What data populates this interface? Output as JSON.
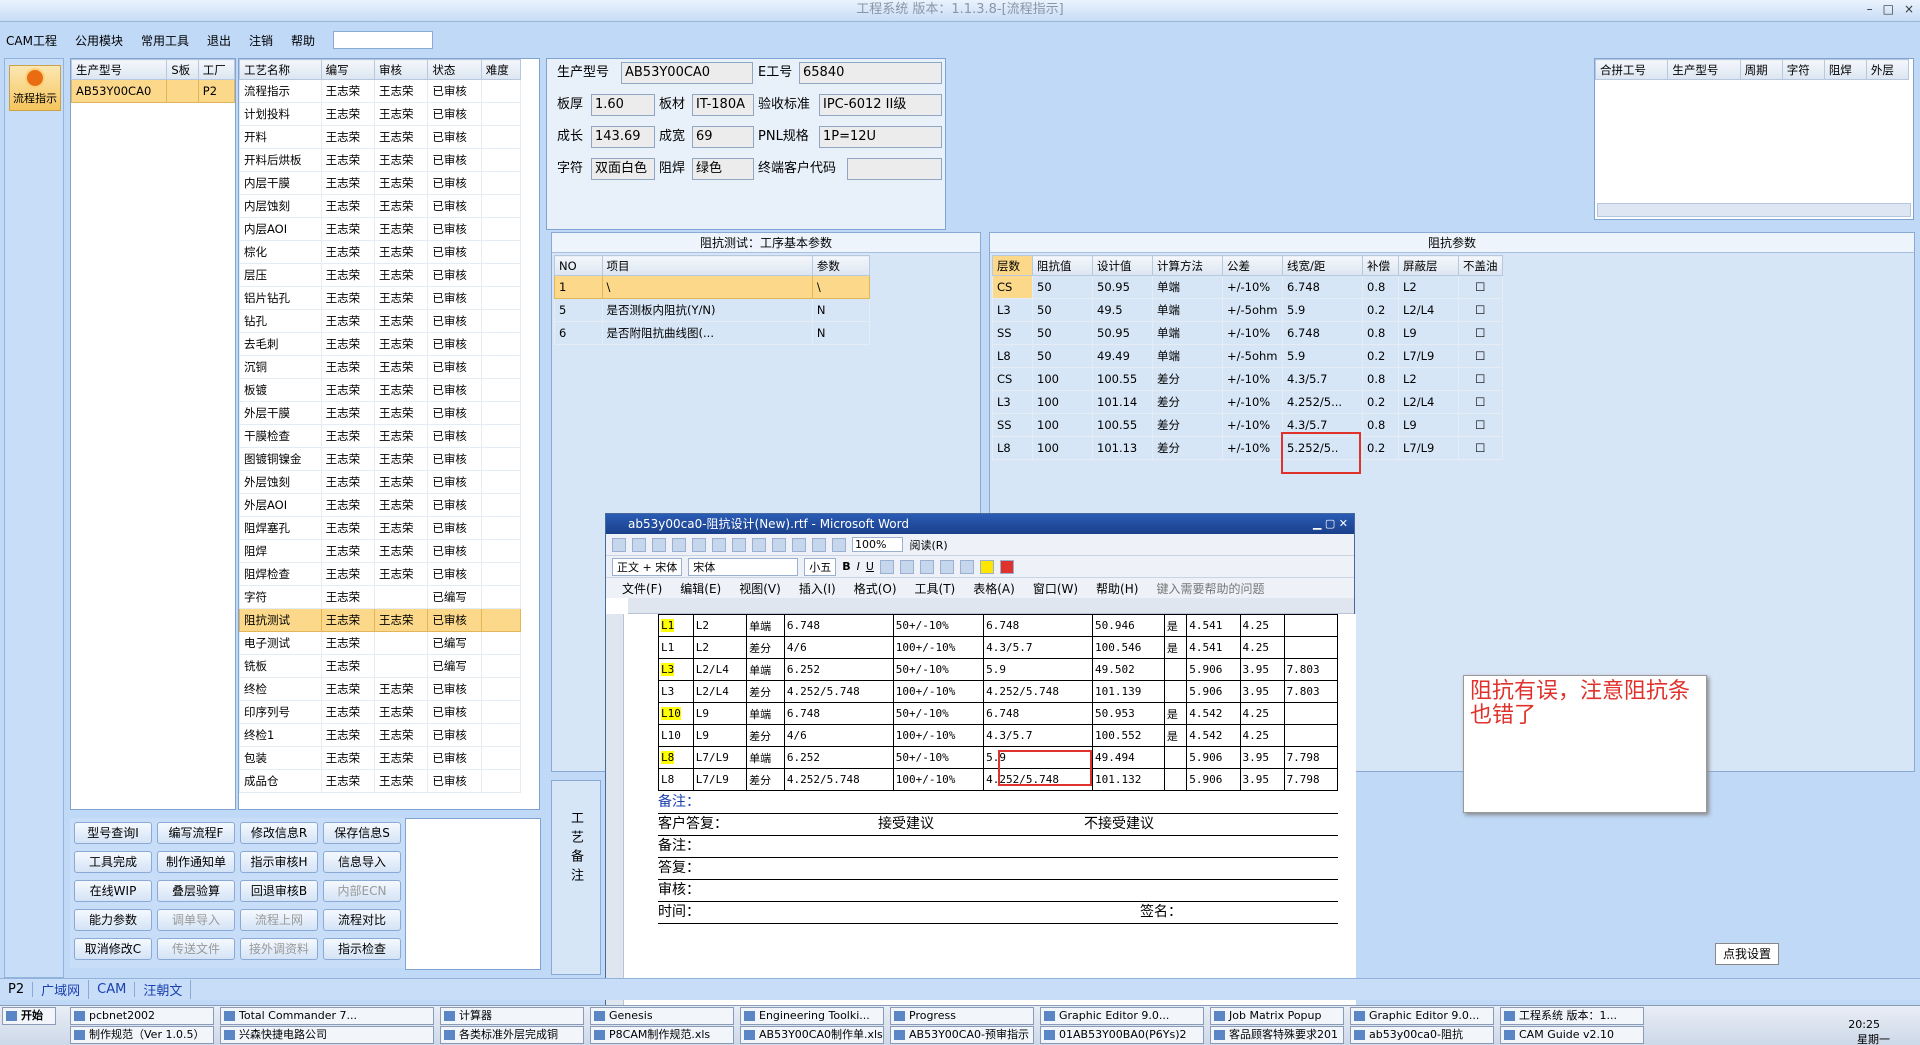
{
  "title": "工程系统 版本：1.1.3.8-[流程指示]",
  "window_buttons": [
    "–",
    "□",
    "×"
  ],
  "menu": [
    "CAM工程",
    "公用模块",
    "常用工具",
    "退出",
    "注销",
    "帮助"
  ],
  "nav": {
    "label": "流程指示"
  },
  "orders": {
    "headers": [
      "生产型号",
      "S板",
      "工厂"
    ],
    "rows": [
      [
        "AB53Y00CA0",
        "",
        "P2"
      ]
    ]
  },
  "process": {
    "headers": [
      "工艺名称",
      "编写",
      "审核",
      "状态",
      "难度"
    ],
    "rows": [
      [
        "流程指示",
        "王志荣",
        "王志荣",
        "已审核",
        ""
      ],
      [
        "计划投料",
        "王志荣",
        "王志荣",
        "已审核",
        ""
      ],
      [
        "开料",
        "王志荣",
        "王志荣",
        "已审核",
        ""
      ],
      [
        "开料后烘板",
        "王志荣",
        "王志荣",
        "已审核",
        ""
      ],
      [
        "内层干膜",
        "王志荣",
        "王志荣",
        "已审核",
        ""
      ],
      [
        "内层蚀刻",
        "王志荣",
        "王志荣",
        "已审核",
        ""
      ],
      [
        "内层AOI",
        "王志荣",
        "王志荣",
        "已审核",
        ""
      ],
      [
        "棕化",
        "王志荣",
        "王志荣",
        "已审核",
        ""
      ],
      [
        "层压",
        "王志荣",
        "王志荣",
        "已审核",
        ""
      ],
      [
        "铝片钻孔",
        "王志荣",
        "王志荣",
        "已审核",
        ""
      ],
      [
        "钻孔",
        "王志荣",
        "王志荣",
        "已审核",
        ""
      ],
      [
        "去毛刺",
        "王志荣",
        "王志荣",
        "已审核",
        ""
      ],
      [
        "沉铜",
        "王志荣",
        "王志荣",
        "已审核",
        ""
      ],
      [
        "板镀",
        "王志荣",
        "王志荣",
        "已审核",
        ""
      ],
      [
        "外层干膜",
        "王志荣",
        "王志荣",
        "已审核",
        ""
      ],
      [
        "干膜检查",
        "王志荣",
        "王志荣",
        "已审核",
        ""
      ],
      [
        "图镀铜镍金",
        "王志荣",
        "王志荣",
        "已审核",
        ""
      ],
      [
        "外层蚀刻",
        "王志荣",
        "王志荣",
        "已审核",
        ""
      ],
      [
        "外层AOI",
        "王志荣",
        "王志荣",
        "已审核",
        ""
      ],
      [
        "阻焊塞孔",
        "王志荣",
        "王志荣",
        "已审核",
        ""
      ],
      [
        "阻焊",
        "王志荣",
        "王志荣",
        "已审核",
        ""
      ],
      [
        "阻焊检查",
        "王志荣",
        "王志荣",
        "已审核",
        ""
      ],
      [
        "字符",
        "王志荣",
        "",
        "已编写",
        ""
      ],
      [
        "阻抗测试",
        "王志荣",
        "王志荣",
        "已审核",
        ""
      ],
      [
        "电子测试",
        "王志荣",
        "",
        "已编写",
        ""
      ],
      [
        "铣板",
        "王志荣",
        "",
        "已编写",
        ""
      ],
      [
        "终检",
        "王志荣",
        "王志荣",
        "已审核",
        ""
      ],
      [
        "印序列号",
        "王志荣",
        "王志荣",
        "已审核",
        ""
      ],
      [
        "终检1",
        "王志荣",
        "王志荣",
        "已审核",
        ""
      ],
      [
        "包装",
        "王志荣",
        "王志荣",
        "已审核",
        ""
      ],
      [
        "成品仓",
        "王志荣",
        "王志荣",
        "已审核",
        ""
      ]
    ],
    "selected": 23
  },
  "info": {
    "prod_label": "生产型号",
    "prod": "AB53Y00CA0",
    "eng_label": "E工号",
    "eng": "65840",
    "thick_label": "板厚",
    "thick": "1.60",
    "mat_label": "板材",
    "mat": "IT-180A",
    "std_label": "验收标准",
    "std": "IPC-6012 II级",
    "len_label": "成长",
    "len": "143.69",
    "wid_label": "成宽",
    "wid": "69",
    "pnl_label": "PNL规格",
    "pnl": "1P=12U",
    "char_label": "字符",
    "char": "双面白色",
    "mask_label": "阻焊",
    "mask": "绿色",
    "cust_label": "终端客户代码",
    "cust": ""
  },
  "merge": {
    "headers": [
      "合拼工号",
      "生产型号",
      "周期",
      "字符",
      "阻焊",
      "外层"
    ]
  },
  "basic": {
    "title": "阻抗测试：工序基本参数",
    "headers": [
      "NO",
      "项目",
      "参数"
    ],
    "rows": [
      [
        "1",
        "\\",
        "\\"
      ],
      [
        "5",
        "是否测板内阻抗(Y/N)",
        "N"
      ],
      [
        "6",
        "是否附阻抗曲线图(...",
        "N"
      ]
    ]
  },
  "imp": {
    "title": "阻抗参数",
    "headers": [
      "层数",
      "阻抗值",
      "设计值",
      "计算方法",
      "公差",
      "线宽/距",
      "补偿",
      "屏蔽层",
      "不盖油"
    ],
    "rows": [
      [
        "CS",
        "50",
        "50.95",
        "单端",
        "+/-10%",
        "6.748",
        "0.8",
        "L2"
      ],
      [
        "L3",
        "50",
        "49.5",
        "单端",
        "+/-5ohm",
        "5.9",
        "0.2",
        "L2/L4"
      ],
      [
        "SS",
        "50",
        "50.95",
        "单端",
        "+/-10%",
        "6.748",
        "0.8",
        "L9"
      ],
      [
        "L8",
        "50",
        "49.49",
        "单端",
        "+/-5ohm",
        "5.9",
        "0.2",
        "L7/L9"
      ],
      [
        "CS",
        "100",
        "100.55",
        "差分",
        "+/-10%",
        "4.3/5.7",
        "0.8",
        "L2"
      ],
      [
        "L3",
        "100",
        "101.14",
        "差分",
        "+/-10%",
        "4.252/5...",
        "0.2",
        "L2/L4"
      ],
      [
        "SS",
        "100",
        "100.55",
        "差分",
        "+/-10%",
        "4.3/5.7",
        "0.8",
        "L9"
      ],
      [
        "L8",
        "100",
        "101.13",
        "差分",
        "+/-10%",
        "5.252/5..",
        "0.2",
        "L7/L9"
      ]
    ]
  },
  "side_label": "工艺备注",
  "buttons": [
    "型号查询I",
    "编写流程F",
    "修改信息R",
    "保存信息S",
    "工具完成",
    "制作通知单",
    "指示审核H",
    "信息导入",
    "在线WIP",
    "叠层验算",
    "回退审核B",
    "内部ECN",
    "能力参数",
    "调单导入",
    "流程上网",
    "流程对比",
    "取消修改C",
    "传送文件",
    "接外调资料",
    "指示检查"
  ],
  "word": {
    "title": "ab53y00ca0-阻抗设计(New).rtf - Microsoft Word",
    "zoom": "100%",
    "read": "阅读(R)",
    "style": "正文 + 宋体",
    "font": "宋体",
    "size": "小五",
    "menu": [
      "文件(F)",
      "编辑(E)",
      "视图(V)",
      "插入(I)",
      "格式(O)",
      "工具(T)",
      "表格(A)",
      "窗口(W)",
      "帮助(H)"
    ],
    "help_placeholder": "键入需要帮助的问题",
    "rows": [
      [
        "L1",
        "L2",
        "单端",
        "6.748",
        "50+/-10%",
        "6.748",
        "50.946",
        "是",
        "4.541",
        "4.25",
        ""
      ],
      [
        "L1",
        "L2",
        "差分",
        "4/6",
        "100+/-10%",
        "4.3/5.7",
        "100.546",
        "是",
        "4.541",
        "4.25",
        ""
      ],
      [
        "L3",
        "L2/L4",
        "单端",
        "6.252",
        "50+/-10%",
        "5.9",
        "49.502",
        "",
        "5.906",
        "3.95",
        "7.803"
      ],
      [
        "L3",
        "L2/L4",
        "差分",
        "4.252/5.748",
        "100+/-10%",
        "4.252/5.748",
        "101.139",
        "",
        "5.906",
        "3.95",
        "7.803"
      ],
      [
        "L10",
        "L9",
        "单端",
        "6.748",
        "50+/-10%",
        "6.748",
        "50.953",
        "是",
        "4.542",
        "4.25",
        ""
      ],
      [
        "L10",
        "L9",
        "差分",
        "4/6",
        "100+/-10%",
        "4.3/5.7",
        "100.552",
        "是",
        "4.542",
        "4.25",
        ""
      ],
      [
        "L8",
        "L7/L9",
        "单端",
        "6.252",
        "50+/-10%",
        "5.9",
        "49.494",
        "",
        "5.906",
        "3.95",
        "7.798"
      ],
      [
        "L8",
        "L7/L9",
        "差分",
        "4.252/5.748",
        "100+/-10%",
        "4.252/5.748",
        "101.132",
        "",
        "5.906",
        "3.95",
        "7.798"
      ]
    ],
    "lines": [
      "备注：",
      "客户答复：",
      "接受建议",
      "不接受建议",
      "备注：",
      "答复：",
      "审核：",
      "时间：",
      "签名："
    ]
  },
  "callout": "阻抗有误，注意阻抗条也错了",
  "settings_tip": "点我设置",
  "status": [
    "P2",
    "广域网",
    "CAM",
    "汪朝文"
  ],
  "taskbar": {
    "start": "开始",
    "row1": [
      "pcbnet2002",
      "Total Commander 7...",
      "计算器",
      "Genesis",
      "Engineering Toolki...",
      "Progress",
      "Graphic Editor 9.0...",
      "Job Matrix Popup",
      "Graphic Editor 9.0...",
      "工程系统 版本：1..."
    ],
    "row2": [
      "制作规范（Ver 1.0.5）",
      "兴森快捷电路公司",
      "各类标准外层完成铜",
      "P8CAM制作规范.xls",
      "AB53Y00CA0制作单.xls",
      "AB53Y00CA0-预审指示",
      "01AB53Y00BA0(P6Ys)2",
      "客品顾客特殊要求201",
      "ab53y00ca0-阻抗",
      "CAM Guide v2.10"
    ],
    "clock": "20:25",
    "day": "星期一"
  }
}
